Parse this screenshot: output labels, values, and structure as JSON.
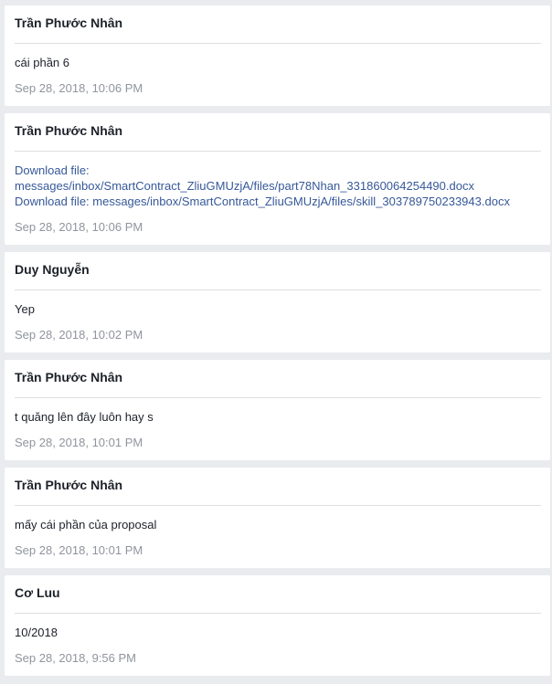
{
  "messages": [
    {
      "sender": "Trần Phước Nhân",
      "text": "cái phần 6",
      "timestamp": "Sep 28, 2018, 10:06 PM"
    },
    {
      "sender": "Trần Phước Nhân",
      "links": [
        "Download file:",
        "messages/inbox/SmartContract_ZliuGMUzjA/files/part78Nhan_331860064254490.docx",
        "Download file: messages/inbox/SmartContract_ZliuGMUzjA/files/skill_303789750233943.docx"
      ],
      "timestamp": "Sep 28, 2018, 10:06 PM"
    },
    {
      "sender": "Duy Nguyễn",
      "text": "Yep",
      "timestamp": "Sep 28, 2018, 10:02 PM"
    },
    {
      "sender": "Trần Phước Nhân",
      "text": "t quăng lên đây luôn hay s",
      "timestamp": "Sep 28, 2018, 10:01 PM"
    },
    {
      "sender": "Trần Phước Nhân",
      "text": "mấy cái phần của proposal",
      "timestamp": "Sep 28, 2018, 10:01 PM"
    },
    {
      "sender": "Cơ Luu",
      "text": "10/2018",
      "timestamp": "Sep 28, 2018, 9:56 PM"
    }
  ]
}
